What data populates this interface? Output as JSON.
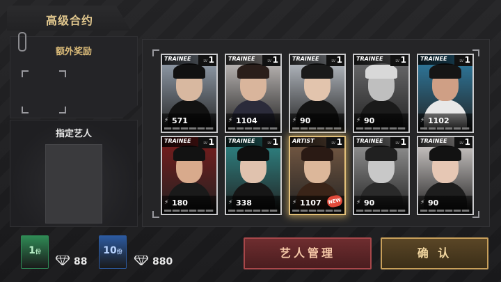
{
  "window": {
    "title": "高级合约"
  },
  "bonus_panel": {
    "label": "额外奖励"
  },
  "artist_panel": {
    "label": "指定艺人"
  },
  "cards": [
    {
      "brand": "TRAINEE",
      "lv_tag": "LV",
      "level": "1",
      "power": "571",
      "new": false,
      "gold": false,
      "art_bg": "#9aa6b4",
      "hair": "#111",
      "skin": "#d8b8a0",
      "body": "#121212"
    },
    {
      "brand": "TRAINEE",
      "lv_tag": "LV",
      "level": "1",
      "power": "1104",
      "new": false,
      "gold": false,
      "art_bg": "#c9c4c2",
      "hair": "#2a1e1a",
      "skin": "#d9b59c",
      "body": "#2b2b3a"
    },
    {
      "brand": "TRAINEE",
      "lv_tag": "LV",
      "level": "1",
      "power": "90",
      "new": false,
      "gold": false,
      "art_bg": "#c0c6ce",
      "hair": "#1a1a1a",
      "skin": "#e2c4ad",
      "body": "#141414"
    },
    {
      "brand": "TRAINEE",
      "lv_tag": "LV",
      "level": "1",
      "power": "90",
      "new": false,
      "gold": false,
      "art_bg": "#6e6e70",
      "hair": "#d8d8d8",
      "skin": "#bfbfbf",
      "body": "#1a1a1a"
    },
    {
      "brand": "TRAINEE",
      "lv_tag": "LV",
      "level": "1",
      "power": "1102",
      "new": false,
      "gold": false,
      "art_bg": "#2f7fa6",
      "hair": "#151515",
      "skin": "#cf9f85",
      "body": "#e8e8e8"
    },
    {
      "brand": "TRAINEE",
      "lv_tag": "LV",
      "level": "1",
      "power": "180",
      "new": false,
      "gold": false,
      "art_bg": "#7a1c1c",
      "hair": "#121212",
      "skin": "#d8aa8c",
      "body": "#1a1a1a"
    },
    {
      "brand": "TRAINEE",
      "lv_tag": "LV",
      "level": "1",
      "power": "338",
      "new": false,
      "gold": false,
      "art_bg": "#2f8a8a",
      "hair": "#0f0f0f",
      "skin": "#e0c2ae",
      "body": "#161616"
    },
    {
      "brand": "ARTIST",
      "lv_tag": "LV",
      "level": "1",
      "power": "1107",
      "new": true,
      "new_label": "NEW",
      "gold": true,
      "art_bg": "#7a5c45",
      "hair": "#2a1a14",
      "skin": "#dcb79a",
      "body": "#3a2418"
    },
    {
      "brand": "TRAINEE",
      "lv_tag": "LV",
      "level": "1",
      "power": "90",
      "new": false,
      "gold": false,
      "art_bg": "#9a9a9a",
      "hair": "#202020",
      "skin": "#c8c8c8",
      "body": "#2a2a2a"
    },
    {
      "brand": "TRAINEE",
      "lv_tag": "LV",
      "level": "1",
      "power": "90",
      "new": false,
      "gold": false,
      "art_bg": "#d9d4d2",
      "hair": "#121212",
      "skin": "#e6c7b4",
      "body": "#1d1d1d"
    }
  ],
  "tiers": [
    {
      "count": "1",
      "unit": "份",
      "price": "88",
      "color": "#2f8a55",
      "text_color": "#b9f0c8"
    },
    {
      "count": "10",
      "unit": "份",
      "price": "880",
      "color": "#2c5aa0",
      "text_color": "#b9d4ff"
    }
  ],
  "buttons": {
    "manage": "艺人管理",
    "confirm": "确 认"
  },
  "colors": {
    "accent_gold": "#e3c98f",
    "danger": "#a8474a"
  }
}
